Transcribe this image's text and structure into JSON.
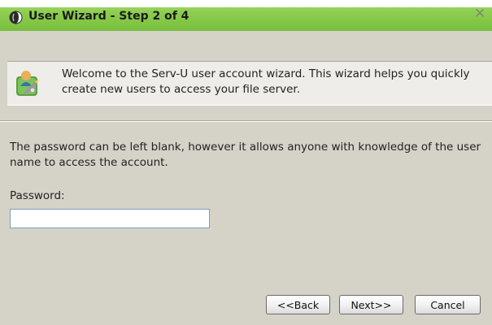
{
  "window": {
    "title": "User Wizard - Step 2 of 4",
    "close_glyph": "✕"
  },
  "banner": {
    "icon": "wizard-user-icon",
    "text": "Welcome to the Serv-U user account wizard. This wizard helps you quickly create new users to access your file server."
  },
  "form": {
    "info_text": "The password can be left blank, however it allows anyone with knowledge of the user name to access the account.",
    "password_label": "Password:",
    "password_value": "",
    "password_placeholder": ""
  },
  "buttons": {
    "back": "<<Back",
    "next": "Next>>",
    "cancel": "Cancel"
  },
  "colors": {
    "titlebar": "#8ccc4e",
    "window_bg": "#d5d2c8"
  }
}
